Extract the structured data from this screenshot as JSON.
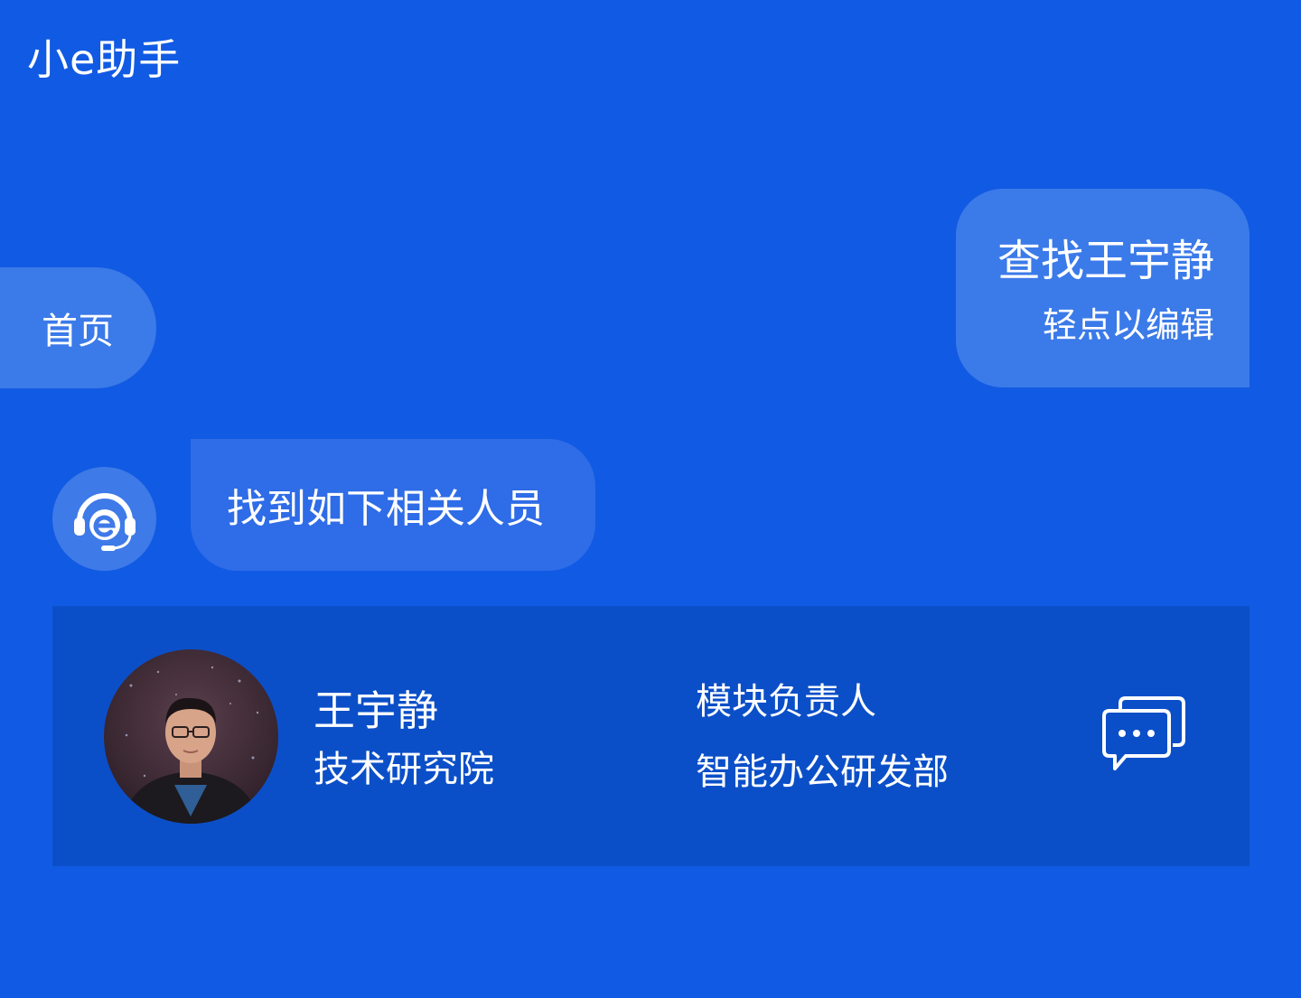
{
  "header": {
    "title": "小e助手"
  },
  "nav": {
    "home_label": "首页"
  },
  "user_message": {
    "text": "查找王宇静",
    "hint": "轻点以编辑"
  },
  "bot_message": {
    "text": "找到如下相关人员",
    "avatar_icon": "headset-e-logo-icon"
  },
  "result_card": {
    "name": "王宇静",
    "organization": "技术研究院",
    "role": "模块负责人",
    "department": "智能办公研发部",
    "photo_icon": "person-photo",
    "action_icon": "chat-bubbles-icon"
  },
  "colors": {
    "background": "#115ae3",
    "bubble": "#3b7ae9",
    "bot_bubble": "#2f6ce7",
    "card": "#0b4fc8"
  }
}
